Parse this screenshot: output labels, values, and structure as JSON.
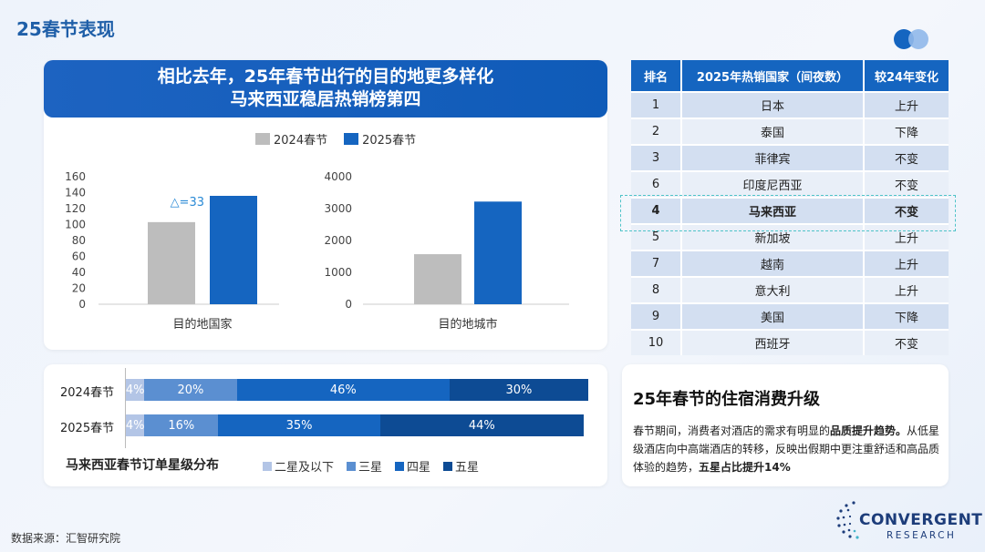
{
  "page": {
    "title": "25春节表现",
    "banner_line1": "相比去年，25年春节出行的目的地更多样化",
    "banner_line2": "马来西亚稳居热销榜第四",
    "source": "数据来源：汇智研究院"
  },
  "colors": {
    "gray": "#bdbdbd",
    "blue": "#1565c0",
    "star2": "#b3c5e6",
    "star3": "#5b8fd1",
    "star4": "#1565c0",
    "star5": "#0d4b94"
  },
  "chart_data": [
    {
      "type": "bar",
      "categories": [
        "目的地国家"
      ],
      "series": [
        {
          "name": "2024春节",
          "values": [
            103
          ]
        },
        {
          "name": "2025春节",
          "values": [
            136
          ]
        }
      ],
      "ylim": [
        0,
        160
      ],
      "yticks": [
        0,
        20,
        40,
        60,
        80,
        100,
        120,
        140,
        160
      ],
      "annotation": "△=33",
      "legend": "top"
    },
    {
      "type": "bar",
      "categories": [
        "目的地城市"
      ],
      "series": [
        {
          "name": "2024春节",
          "values": [
            1570
          ]
        },
        {
          "name": "2025春节",
          "values": [
            3220
          ]
        }
      ],
      "ylim": [
        0,
        4000
      ],
      "yticks": [
        0,
        1000,
        2000,
        3000,
        4000
      ]
    },
    {
      "type": "bar",
      "stacked": true,
      "orientation": "horizontal",
      "title": "马来西亚春节订单星级分布",
      "categories": [
        "2024春节",
        "2025春节"
      ],
      "series": [
        {
          "name": "二星及以下",
          "values": [
            4,
            4
          ]
        },
        {
          "name": "三星",
          "values": [
            20,
            16
          ]
        },
        {
          "name": "四星",
          "values": [
            46,
            35
          ]
        },
        {
          "name": "五星",
          "values": [
            30,
            44
          ]
        }
      ],
      "labels": [
        [
          "4%",
          "20%",
          "46%",
          "30%"
        ],
        [
          "4%",
          "16%",
          "35%",
          "44%"
        ]
      ],
      "legend": "bottom"
    }
  ],
  "table": {
    "headers": [
      "排名",
      "2025年热销国家（间夜数）",
      "较24年变化"
    ],
    "rows": [
      [
        "1",
        "日本",
        "上升"
      ],
      [
        "2",
        "泰国",
        "下降"
      ],
      [
        "3",
        "菲律宾",
        "不变"
      ],
      [
        "6",
        "印度尼西亚",
        "不变"
      ],
      [
        "4",
        "马来西亚",
        "不变"
      ],
      [
        "5",
        "新加坡",
        "上升"
      ],
      [
        "7",
        "越南",
        "上升"
      ],
      [
        "8",
        "意大利",
        "上升"
      ],
      [
        "9",
        "美国",
        "下降"
      ],
      [
        "10",
        "西班牙",
        "不变"
      ]
    ],
    "highlight_row": 4
  },
  "insight": {
    "title": "25年春节的住宿消费升级",
    "body_1": "春节期间，消费者对酒店的需求有明显的",
    "body_bold_1": "品质提升趋势。",
    "body_2": "从低星级酒店向中高端酒店的转移，反映出假期中更注重舒适和高品质体验的趋势，",
    "body_bold_2": "五星占比提升14%"
  },
  "logo": {
    "line1": "CONVERGENT",
    "line2": "RESEARCH"
  }
}
